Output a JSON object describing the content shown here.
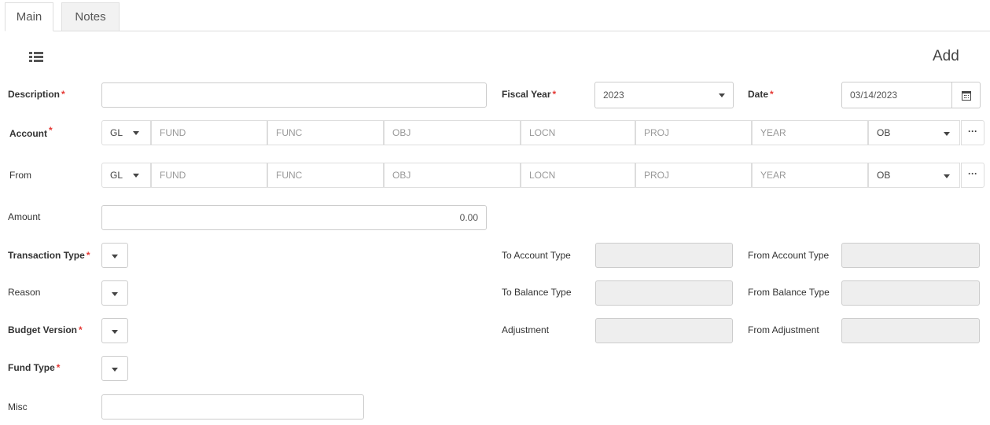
{
  "tabs": [
    {
      "label": "Main",
      "active": true
    },
    {
      "label": "Notes",
      "active": false
    }
  ],
  "form": {
    "mode_title": "Add",
    "description": {
      "label": "Description",
      "value": ""
    },
    "fiscal_year": {
      "label": "Fiscal Year",
      "value": "2023"
    },
    "date": {
      "label": "Date",
      "value": "03/14/2023"
    },
    "account": {
      "label": "Account",
      "ledger": "GL",
      "segments": [
        "FUND",
        "FUNC",
        "OBJ",
        "LOCN",
        "PROJ",
        "YEAR"
      ],
      "balance": "OB"
    },
    "from": {
      "label": "From",
      "ledger": "GL",
      "segments": [
        "FUND",
        "FUNC",
        "OBJ",
        "LOCN",
        "PROJ",
        "YEAR"
      ],
      "balance": "OB"
    },
    "amount": {
      "label": "Amount",
      "value": "0.00"
    },
    "transaction_type": {
      "label": "Transaction Type"
    },
    "reason": {
      "label": "Reason"
    },
    "budget_version": {
      "label": "Budget Version"
    },
    "fund_type": {
      "label": "Fund Type"
    },
    "misc": {
      "label": "Misc",
      "value": ""
    },
    "to_account_type": {
      "label": "To Account Type",
      "value": ""
    },
    "from_account_type": {
      "label": "From Account Type",
      "value": ""
    },
    "to_balance_type": {
      "label": "To Balance Type",
      "value": ""
    },
    "from_balance_type": {
      "label": "From Balance Type",
      "value": ""
    },
    "adjustment": {
      "label": "Adjustment",
      "value": ""
    },
    "from_adjustment": {
      "label": "From Adjustment",
      "value": ""
    },
    "required_marker": "*",
    "more_glyph": "···"
  },
  "colors": {
    "required": "#e53935",
    "border": "#cccccc",
    "readonly_bg": "#eeeeee"
  },
  "icons": [
    "list-view-icon",
    "caret-down-icon",
    "calendar-icon",
    "ellipsis-icon"
  ]
}
